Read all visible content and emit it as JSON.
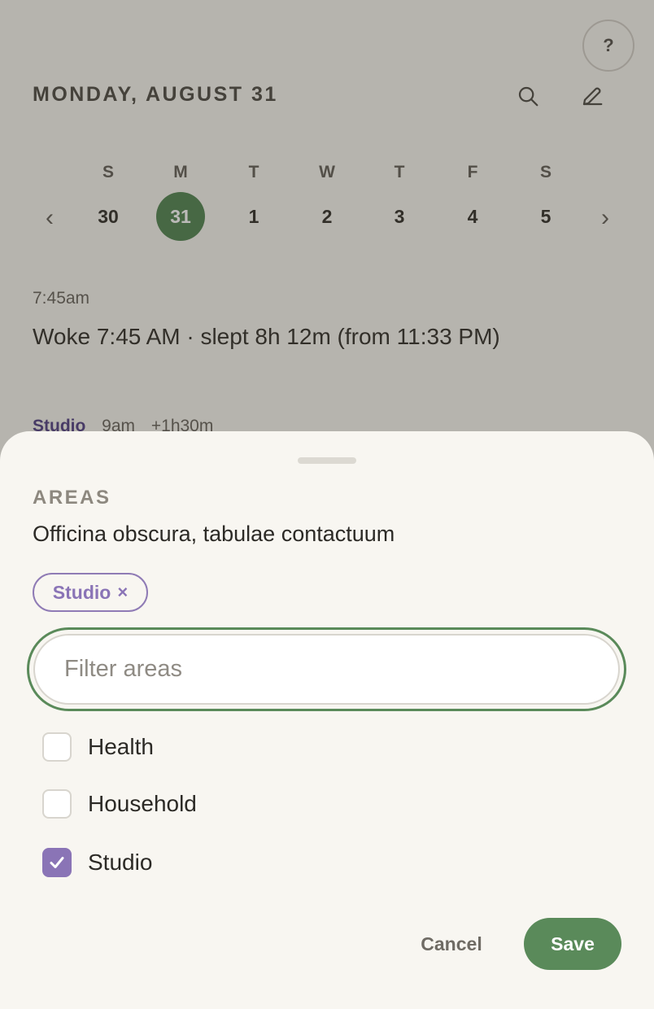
{
  "header": {
    "help_label": "?",
    "date_title": "MONDAY, AUGUST 31",
    "search_icon": "search-icon",
    "edit_icon": "pencil-icon"
  },
  "week": {
    "prev_label": "‹",
    "next_label": "›",
    "days": [
      {
        "weekday": "S",
        "date": "30"
      },
      {
        "weekday": "M",
        "date": "31"
      },
      {
        "weekday": "T",
        "date": "1"
      },
      {
        "weekday": "W",
        "date": "2"
      },
      {
        "weekday": "T",
        "date": "3"
      },
      {
        "weekday": "F",
        "date": "4"
      },
      {
        "weekday": "S",
        "date": "5"
      }
    ],
    "selected_date": "31"
  },
  "entry": {
    "time": "7:45am",
    "text": "Woke 7:45 AM · slept 8h 12m (from 11:33 PM)"
  },
  "event": {
    "area": "Studio",
    "time": "9am",
    "duration": "+1h30m"
  },
  "sheet": {
    "label": "AREAS",
    "title": "Officina obscura, tabulae contactuum",
    "chip_label": "Studio",
    "chip_remove": "×",
    "filter_placeholder": "Filter areas",
    "filter_value": "",
    "options": [
      {
        "label": "Health",
        "checked": false
      },
      {
        "label": "Household",
        "checked": false
      },
      {
        "label": "Studio",
        "checked": true
      }
    ],
    "cancel_label": "Cancel",
    "save_label": "Save"
  },
  "colors": {
    "accent_green": "#5a8a5a",
    "accent_purple": "#8a74b6",
    "background": "#f8f6f1"
  }
}
